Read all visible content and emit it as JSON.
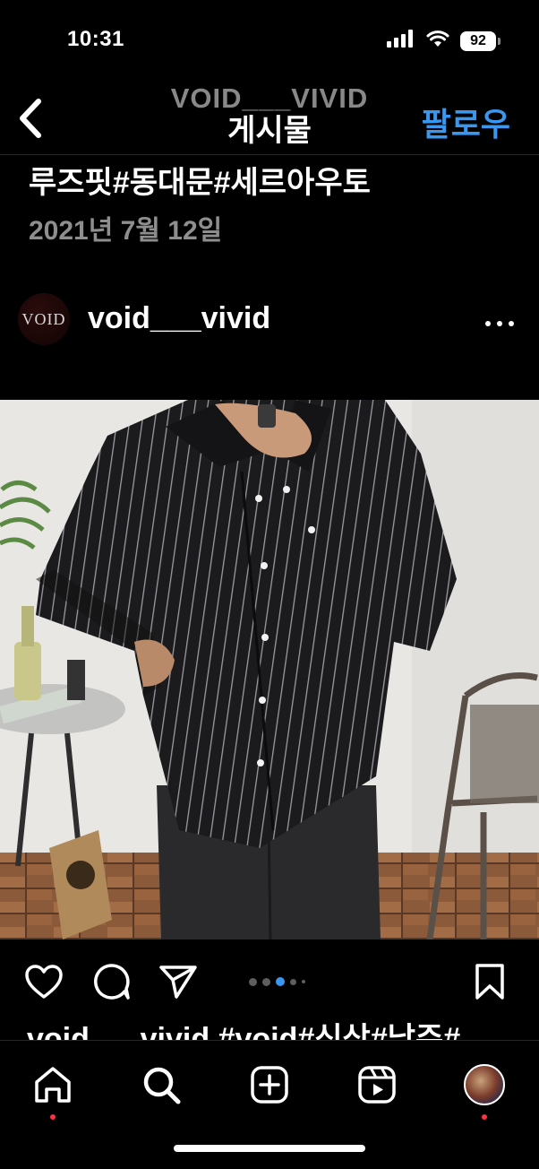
{
  "status_bar": {
    "time": "10:31",
    "battery_level": "92"
  },
  "header": {
    "account_name": "VOID___VIVID",
    "title": "게시물",
    "follow_label": "팔로우",
    "accent_color": "#3a97f0"
  },
  "post": {
    "caption_top": "루즈핏#동대문#세르아우토",
    "date": "2021년 7월 12일",
    "avatar_text": "VOID",
    "username": "void___vivid",
    "carousel": {
      "total": 5,
      "current": 3
    },
    "caption_preview": "void___vivid #void#신상#남주#"
  },
  "icons": {
    "back": "chevron-left-icon",
    "like": "heart-icon",
    "comment": "comment-icon",
    "share": "send-icon",
    "save": "bookmark-icon",
    "more": "more-horizontal-icon"
  },
  "tab_bar": {
    "items": [
      {
        "name": "home",
        "icon": "home-icon",
        "notification_dot": true
      },
      {
        "name": "search",
        "icon": "search-icon",
        "notification_dot": false
      },
      {
        "name": "create",
        "icon": "plus-square-icon",
        "notification_dot": false
      },
      {
        "name": "reels",
        "icon": "reels-icon",
        "notification_dot": false
      },
      {
        "name": "profile",
        "icon": "profile-avatar",
        "notification_dot": true
      }
    ]
  }
}
